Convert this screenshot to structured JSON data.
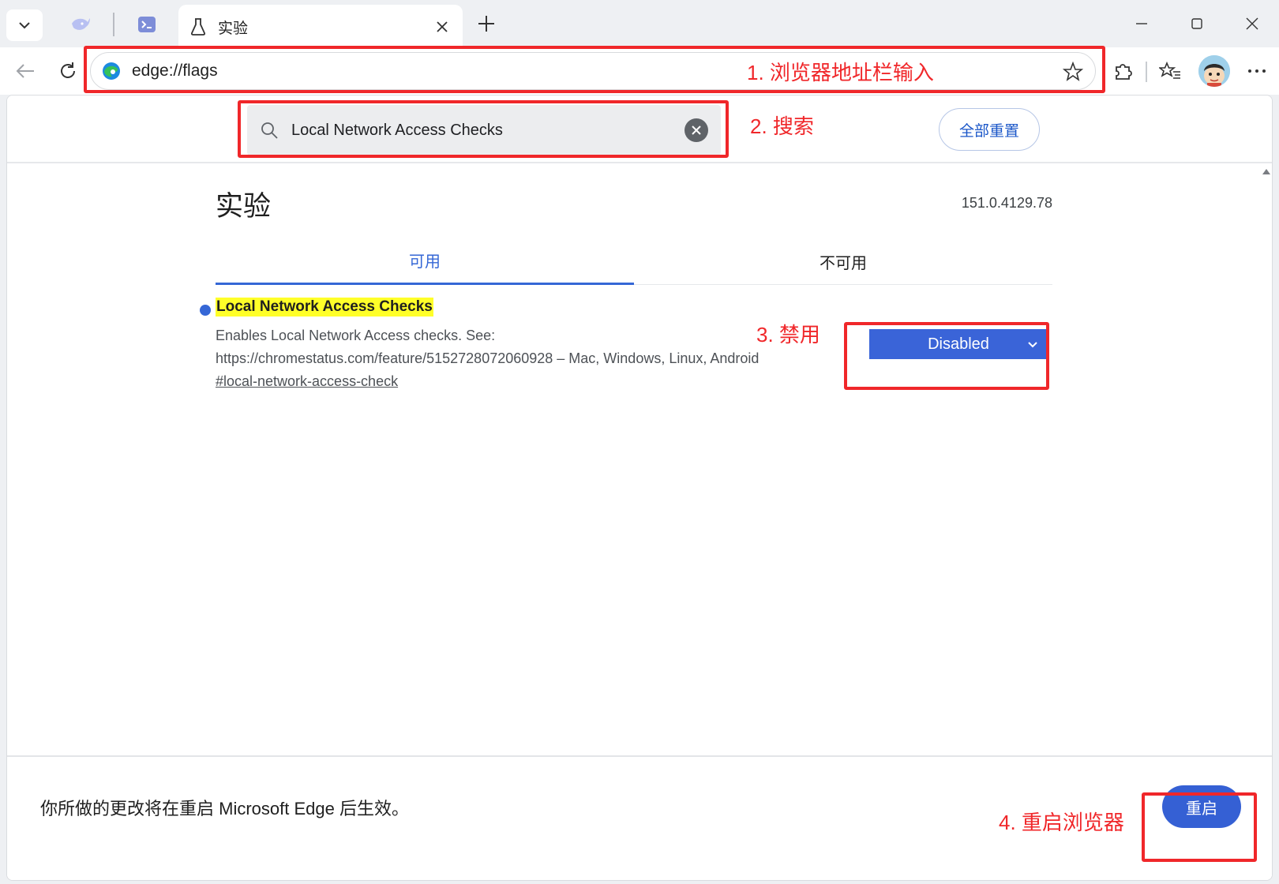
{
  "browser": {
    "tab_title": "实验",
    "address_url": "edge://flags"
  },
  "header": {
    "search_query": "Local Network Access Checks",
    "reset_all_label": "全部重置"
  },
  "page": {
    "title": "实验",
    "version": "151.0.4129.78",
    "tabs": [
      {
        "label": "可用",
        "selected": true
      },
      {
        "label": "不可用",
        "selected": false
      }
    ]
  },
  "flag": {
    "name": "Local Network Access Checks",
    "description_line1": "Enables Local Network Access checks. See:",
    "description_line2": "https://chromestatus.com/feature/5152728072060928 – Mac, Windows, Linux, Android",
    "link": "#local-network-access-check",
    "selected_value": "Disabled"
  },
  "footer": {
    "message": "你所做的更改将在重启 Microsoft Edge 后生效。",
    "relaunch_label": "重启"
  },
  "annotations": {
    "step1": "1. 浏览器地址栏输入",
    "step2": "2. 搜索",
    "step3": "3. 禁用",
    "step4": "4. 重启浏览器"
  },
  "colors": {
    "accent": "#3567d6",
    "annotation": "#f0272a",
    "highlight": "#ffff29",
    "select_bg": "#3a64d8"
  }
}
